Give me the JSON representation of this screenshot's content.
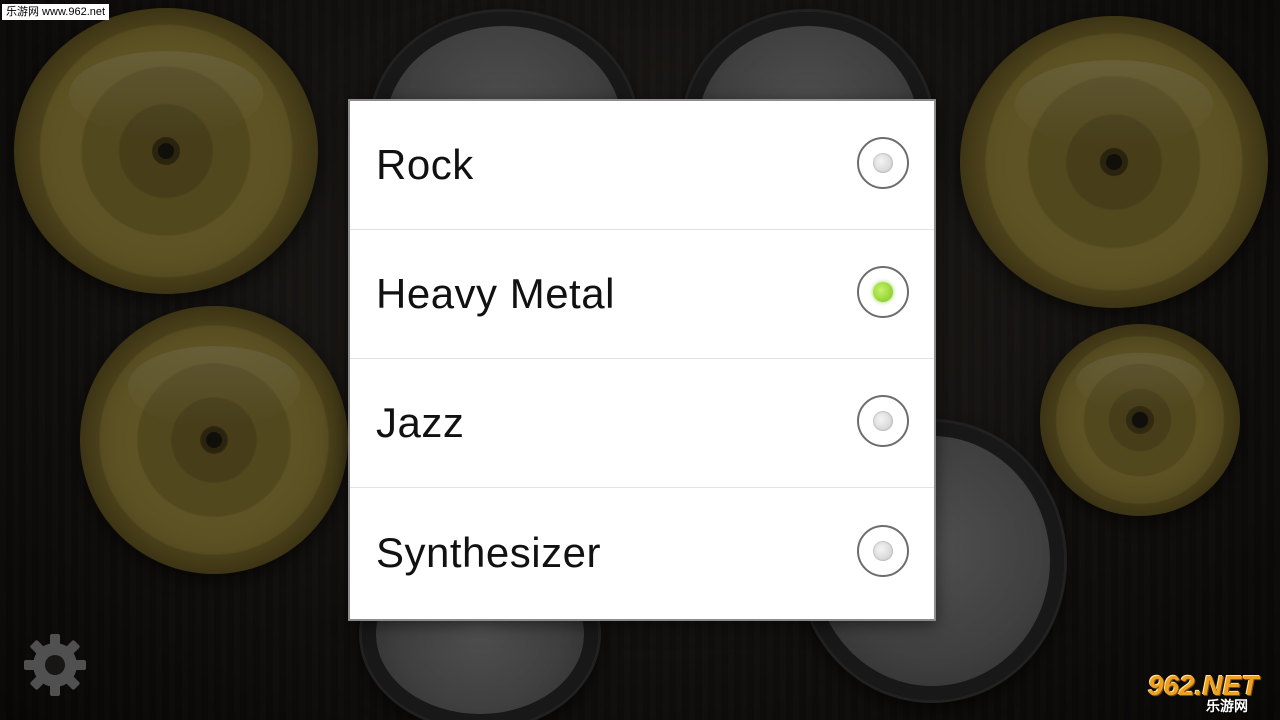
{
  "watermark": {
    "site_text": "乐游网 www.962.net"
  },
  "dialog": {
    "options": [
      {
        "label": "Rock",
        "checked": false
      },
      {
        "label": "Heavy Metal",
        "checked": true
      },
      {
        "label": "Jazz",
        "checked": false
      },
      {
        "label": "Synthesizer",
        "checked": false
      }
    ]
  },
  "toolbar": {
    "settings_icon": "gear-icon"
  },
  "brand_logo": {
    "primary": "962.NET",
    "secondary": "乐游网"
  },
  "colors": {
    "selected_radio": "#7cc41e",
    "dialog_background": "#ffffff",
    "cymbal": "#a28f3e"
  }
}
